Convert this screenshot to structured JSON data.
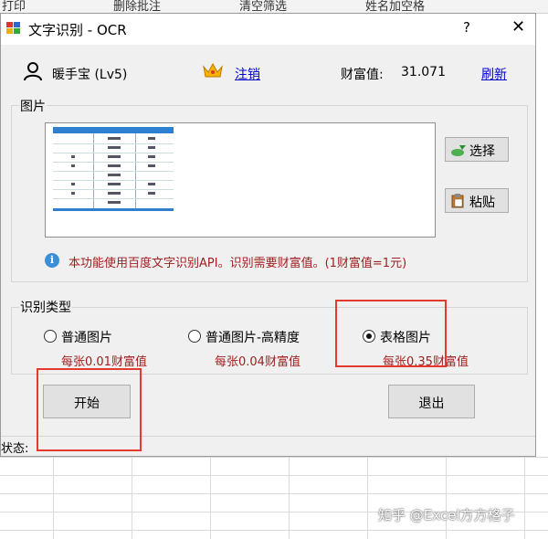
{
  "background": {
    "ribbon": [
      "打印",
      "删除批注",
      "清空筛选",
      "姓名加空格"
    ],
    "watermark": "知乎 @Excel方方格子"
  },
  "window": {
    "title": "文字识别 - OCR",
    "help": "?",
    "close": "✕"
  },
  "user": {
    "name": "暖手宝 (Lv5)",
    "logout": "注销",
    "wealth_label": "财富值:",
    "wealth_value": "31.071",
    "refresh": "刷新"
  },
  "image_group": {
    "legend": "图片",
    "select_button": "选择",
    "paste_button": "粘贴",
    "info": "本功能使用百度文字识别API。识别需要财富值。(1财富值=1元)"
  },
  "type_group": {
    "legend": "识别类型",
    "options": [
      {
        "label": "普通图片",
        "cost": "每张0.01财富值",
        "selected": false
      },
      {
        "label": "普通图片-高精度",
        "cost": "每张0.04财富值",
        "selected": false
      },
      {
        "label": "表格图片",
        "cost": "每张0.35财富值",
        "selected": true
      }
    ]
  },
  "actions": {
    "start": "开始",
    "exit": "退出"
  },
  "status": {
    "label": "状态:"
  },
  "colors": {
    "accent_link": "#0000cc",
    "note_red": "#a02020",
    "annotation": "#e53a2e"
  }
}
